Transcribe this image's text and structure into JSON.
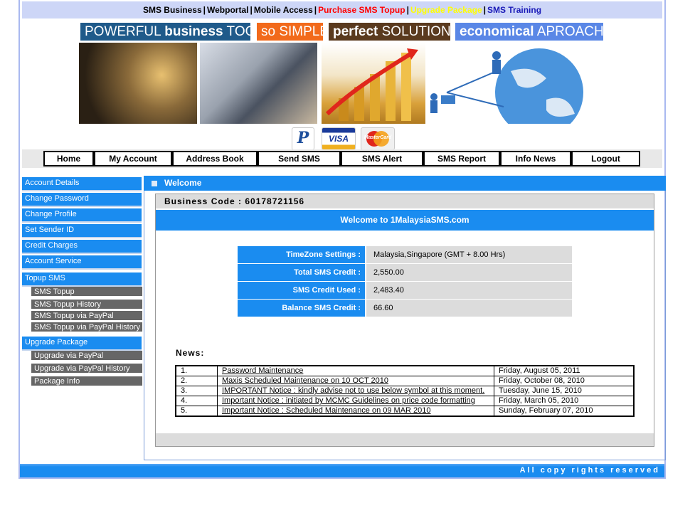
{
  "top_links": [
    {
      "label": "SMS Business",
      "color": "#000000"
    },
    {
      "label": "Webportal",
      "color": "#000000"
    },
    {
      "label": "Mobile Access",
      "color": "#000000"
    },
    {
      "label": "Purchase SMS Topup",
      "color": "#ff0000"
    },
    {
      "label": "Upgrade Package",
      "color": "#ffff00"
    },
    {
      "label": "SMS Training",
      "color": "#1a1ab8"
    }
  ],
  "taglines": [
    {
      "pre": "POWERFUL ",
      "bold": "business",
      "post": " TOOL",
      "bg": "#1f5a8a"
    },
    {
      "pre": "so SIMPLE",
      "bold": "",
      "post": "",
      "bg": "#f26a1b"
    },
    {
      "pre": "",
      "bold": "perfect",
      "post": " SOLUTION",
      "bg": "#5a3a1e"
    },
    {
      "pre": "",
      "bold": "economical",
      "post": " APROACH",
      "bg": "#5a87e6"
    }
  ],
  "payment_icons": [
    "paypal-icon",
    "visa-icon",
    "mastercard-icon"
  ],
  "payment_labels": {
    "paypal": "P",
    "visa": "VISA",
    "mastercard": "MasterCard"
  },
  "nav": [
    "Home",
    "My Account",
    "Address Book",
    "Send SMS",
    "SMS Alert",
    "SMS Report",
    "Info News",
    "Logout"
  ],
  "sidebar": {
    "account_details": "Account Details",
    "change_password": "Change Password",
    "change_profile": "Change Profile",
    "set_sender_id": "Set Sender ID",
    "credit_charges": "Credit Charges",
    "account_service": "Account Service",
    "topup_sms": "Topup SMS",
    "sms_topup": "SMS Topup",
    "sms_topup_history": "SMS Topup History",
    "sms_topup_paypal": "SMS Topup via PayPal",
    "sms_topup_paypal_history": "SMS Topup via PayPal History",
    "upgrade_package": "Upgrade Package",
    "upgrade_paypal": "Upgrade via PayPal",
    "upgrade_paypal_history": "Upgrade via PayPal History",
    "package_info": "Package Info"
  },
  "welcome": {
    "title": "Welcome",
    "business_code": "Business Code : 60178721156",
    "message": "Welcome to 1MalaysiaSMS.com"
  },
  "account_info": [
    {
      "label": "TimeZone Settings  :",
      "value": "Malaysia,Singapore (GMT + 8.00 Hrs)"
    },
    {
      "label": "Total SMS Credit  :",
      "value": "2,550.00"
    },
    {
      "label": "SMS Credit Used  :",
      "value": "2,483.40"
    },
    {
      "label": "Balance SMS Credit  :",
      "value": "66.60"
    }
  ],
  "news": {
    "label": "News:",
    "items": [
      {
        "no": "1.",
        "title": "Password Maintenance",
        "date": "Friday, August 05, 2011"
      },
      {
        "no": "2.",
        "title": "Maxis Scheduled Maintenance on 10 OCT 2010",
        "date": "Friday, October 08, 2010"
      },
      {
        "no": "3.",
        "title": "IMPORTANT Notice : kindly advise not to use below symbol at this moment.",
        "date": "Tuesday, June 15, 2010"
      },
      {
        "no": "4.",
        "title": "Important Notice : initiated by MCMC Guidelines on price code formatting",
        "date": "Friday, March 05, 2010"
      },
      {
        "no": "5.",
        "title": "Important Notice : Scheduled Maintenance on 09 MAR 2010",
        "date": "Sunday, February 07, 2010"
      }
    ]
  },
  "footer": "All copy rights reserved"
}
